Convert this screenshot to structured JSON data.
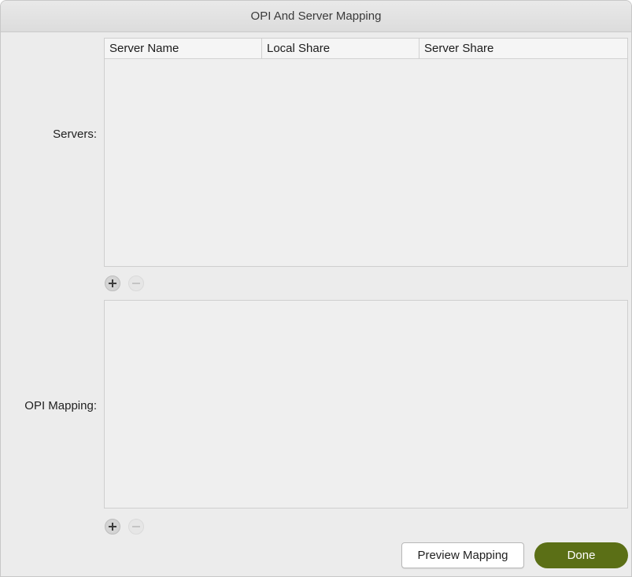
{
  "window": {
    "title": "OPI And Server Mapping"
  },
  "servers": {
    "label": "Servers:",
    "columns": [
      "Server Name",
      "Local Share",
      "Server Share"
    ],
    "rows": []
  },
  "opi_mapping": {
    "label": "OPI Mapping:",
    "rows": []
  },
  "icons": {
    "add": "plus-circle-icon",
    "remove": "minus-circle-icon"
  },
  "buttons": {
    "preview_label": "Preview Mapping",
    "done_label": "Done"
  },
  "colors": {
    "done_button": "#5b6f16",
    "window_bg": "#ececec"
  }
}
